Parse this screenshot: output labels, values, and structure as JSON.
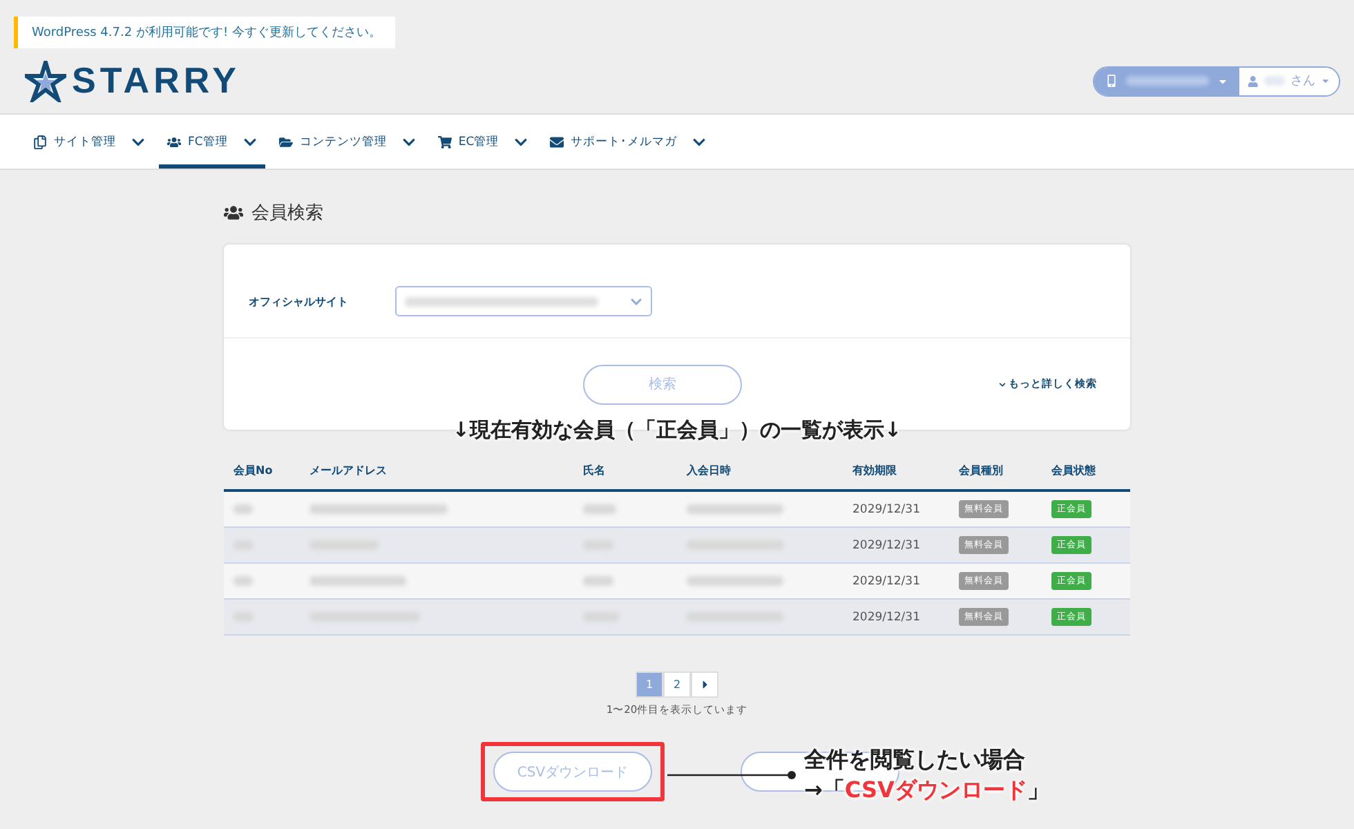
{
  "notice": {
    "text": "WordPress 4.7.2 が利用可能です!",
    "link": "今すぐ更新してください。"
  },
  "header": {
    "logo": "STARRY",
    "user_suffix": "さん"
  },
  "nav": [
    {
      "label": "サイト管理",
      "selected": false
    },
    {
      "label": "FC管理",
      "selected": true
    },
    {
      "label": "コンテンツ管理",
      "selected": false
    },
    {
      "label": "EC管理",
      "selected": false
    },
    {
      "label": "サポート･メルマガ",
      "selected": false
    }
  ],
  "page_title": "会員検索",
  "search": {
    "field_label": "オフィシャルサイト",
    "button": "検索",
    "advanced_link": "もっと詳しく検索"
  },
  "annotation_top": "↓現在有効な会員（「正会員」）の一覧が表示↓",
  "table": {
    "columns": [
      "会員No",
      "メールアドレス",
      "氏名",
      "入会日時",
      "有効期限",
      "会員種別",
      "会員状態"
    ],
    "rows": [
      {
        "expiry": "2029/12/31",
        "type": "無料会員",
        "status": "正会員"
      },
      {
        "expiry": "2029/12/31",
        "type": "無料会員",
        "status": "正会員"
      },
      {
        "expiry": "2029/12/31",
        "type": "無料会員",
        "status": "正会員"
      },
      {
        "expiry": "2029/12/31",
        "type": "無料会員",
        "status": "正会員"
      }
    ]
  },
  "pagination": {
    "pages": [
      {
        "label": "1",
        "selected": true
      },
      {
        "label": "2",
        "selected": false
      }
    ],
    "summary": "1〜20件目を表示しています"
  },
  "csv_button": "CSVダウンロード",
  "callout": {
    "line1": "全件を閲覧したい場合",
    "prefix": "→「",
    "highlight": "CSVダウンロード",
    "suffix": "」"
  }
}
